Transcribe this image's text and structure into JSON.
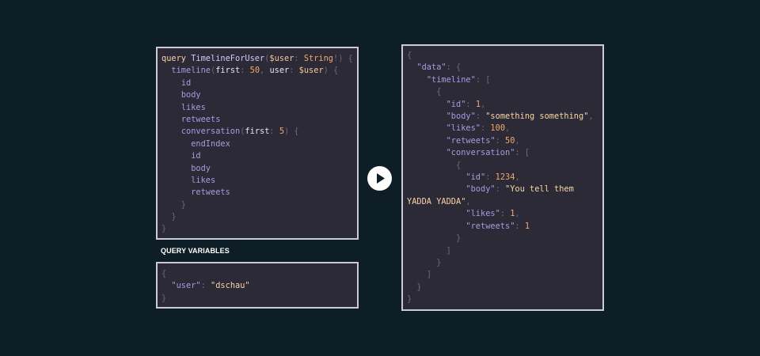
{
  "query": {
    "lines": [
      [
        [
          "kw",
          "query "
        ],
        [
          "def",
          "TimelineForUser"
        ],
        [
          "pun",
          "("
        ],
        [
          "var",
          "$user"
        ],
        [
          "pun",
          ": "
        ],
        [
          "typ",
          "String"
        ],
        [
          "pun",
          "!) {"
        ]
      ],
      [
        [
          "pun",
          "  "
        ],
        [
          "fld",
          "timeline"
        ],
        [
          "pun",
          "("
        ],
        [
          "arg",
          "first"
        ],
        [
          "pun",
          ": "
        ],
        [
          "num",
          "50"
        ],
        [
          "pun",
          ", "
        ],
        [
          "arg",
          "user"
        ],
        [
          "pun",
          ": "
        ],
        [
          "var",
          "$user"
        ],
        [
          "pun",
          ") {"
        ]
      ],
      [
        [
          "pun",
          "    "
        ],
        [
          "fld",
          "id"
        ]
      ],
      [
        [
          "pun",
          "    "
        ],
        [
          "fld",
          "body"
        ]
      ],
      [
        [
          "pun",
          "    "
        ],
        [
          "fld",
          "likes"
        ]
      ],
      [
        [
          "pun",
          "    "
        ],
        [
          "fld",
          "retweets"
        ]
      ],
      [
        [
          "pun",
          "    "
        ],
        [
          "fld",
          "conversation"
        ],
        [
          "pun",
          "("
        ],
        [
          "arg",
          "first"
        ],
        [
          "pun",
          ": "
        ],
        [
          "num",
          "5"
        ],
        [
          "pun",
          ") {"
        ]
      ],
      [
        [
          "pun",
          "      "
        ],
        [
          "fld",
          "endIndex"
        ]
      ],
      [
        [
          "pun",
          "      "
        ],
        [
          "fld",
          "id"
        ]
      ],
      [
        [
          "pun",
          "      "
        ],
        [
          "fld",
          "body"
        ]
      ],
      [
        [
          "pun",
          "      "
        ],
        [
          "fld",
          "likes"
        ]
      ],
      [
        [
          "pun",
          "      "
        ],
        [
          "fld",
          "retweets"
        ]
      ],
      [
        [
          "pun",
          "    }"
        ]
      ],
      [
        [
          "pun",
          "  }"
        ]
      ],
      [
        [
          "pun",
          "}"
        ]
      ]
    ]
  },
  "variables": {
    "title": "QUERY VARIABLES",
    "lines": [
      [
        [
          "pun",
          "{"
        ]
      ],
      [
        [
          "pun",
          "  "
        ],
        [
          "key",
          "\"user\""
        ],
        [
          "pun",
          ": "
        ],
        [
          "str",
          "\"dschau\""
        ]
      ],
      [
        [
          "pun",
          "}"
        ]
      ]
    ]
  },
  "result": {
    "lines": [
      [
        [
          "pun",
          "{"
        ]
      ],
      [
        [
          "pun",
          "  "
        ],
        [
          "key",
          "\"data\""
        ],
        [
          "pun",
          ": {"
        ]
      ],
      [
        [
          "pun",
          "    "
        ],
        [
          "key",
          "\"timeline\""
        ],
        [
          "pun",
          ": ["
        ]
      ],
      [
        [
          "pun",
          "      {"
        ]
      ],
      [
        [
          "pun",
          "        "
        ],
        [
          "key",
          "\"id\""
        ],
        [
          "pun",
          ": "
        ],
        [
          "num",
          "1"
        ],
        [
          "pun",
          ","
        ]
      ],
      [
        [
          "pun",
          "        "
        ],
        [
          "key",
          "\"body\""
        ],
        [
          "pun",
          ": "
        ],
        [
          "str",
          "\"something something\""
        ],
        [
          "pun",
          ","
        ]
      ],
      [
        [
          "pun",
          "        "
        ],
        [
          "key",
          "\"likes\""
        ],
        [
          "pun",
          ": "
        ],
        [
          "num",
          "100"
        ],
        [
          "pun",
          ","
        ]
      ],
      [
        [
          "pun",
          "        "
        ],
        [
          "key",
          "\"retweets\""
        ],
        [
          "pun",
          ": "
        ],
        [
          "num",
          "50"
        ],
        [
          "pun",
          ","
        ]
      ],
      [
        [
          "pun",
          "        "
        ],
        [
          "key",
          "\"conversation\""
        ],
        [
          "pun",
          ": ["
        ]
      ],
      [
        [
          "pun",
          "          {"
        ]
      ],
      [
        [
          "pun",
          "            "
        ],
        [
          "key",
          "\"id\""
        ],
        [
          "pun",
          ": "
        ],
        [
          "num",
          "1234"
        ],
        [
          "pun",
          ","
        ]
      ],
      [
        [
          "pun",
          "            "
        ],
        [
          "key",
          "\"body\""
        ],
        [
          "pun",
          ": "
        ],
        [
          "str",
          "\"You tell them YADDA YADDA\""
        ],
        [
          "pun",
          ","
        ]
      ],
      [
        [
          "pun",
          "            "
        ],
        [
          "key",
          "\"likes\""
        ],
        [
          "pun",
          ": "
        ],
        [
          "num",
          "1"
        ],
        [
          "pun",
          ","
        ]
      ],
      [
        [
          "pun",
          "            "
        ],
        [
          "key",
          "\"retweets\""
        ],
        [
          "pun",
          ": "
        ],
        [
          "num",
          "1"
        ]
      ],
      [
        [
          "pun",
          "          }"
        ]
      ],
      [
        [
          "pun",
          "        ]"
        ]
      ],
      [
        [
          "pun",
          "      }"
        ]
      ],
      [
        [
          "pun",
          "    ]"
        ]
      ],
      [
        [
          "pun",
          "  }"
        ]
      ],
      [
        [
          "pun",
          "}"
        ]
      ]
    ]
  },
  "execute": {
    "icon": "play-icon"
  }
}
